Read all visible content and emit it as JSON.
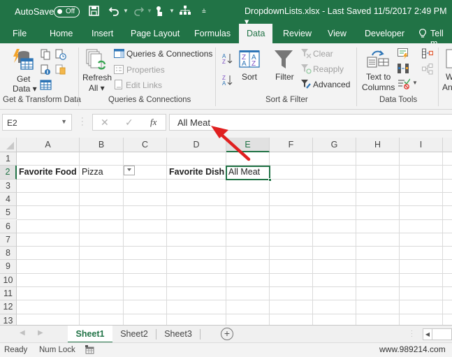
{
  "titlebar": {
    "autosave_label": "AutoSave",
    "autosave_state": "Off",
    "document_title": "DropdownLists.xlsx  -  Last Saved 11/5/2017 2:49 PM  ▾",
    "icons": [
      "save-icon",
      "undo-icon",
      "redo-icon",
      "touch-mode-icon",
      "workflow-icon",
      "customize-qat-icon"
    ]
  },
  "tabs": [
    {
      "label": "File",
      "active": false
    },
    {
      "label": "Home",
      "active": false
    },
    {
      "label": "Insert",
      "active": false
    },
    {
      "label": "Page Layout",
      "active": false
    },
    {
      "label": "Formulas",
      "active": false
    },
    {
      "label": "Data",
      "active": true
    },
    {
      "label": "Review",
      "active": false
    },
    {
      "label": "View",
      "active": false
    },
    {
      "label": "Developer",
      "active": false
    },
    {
      "label": "Tell m",
      "active": false
    }
  ],
  "ribbon": {
    "get_transform": {
      "get_data_line1": "Get",
      "get_data_line2": "Data ▾",
      "group_label": "Get & Transform Data"
    },
    "queries": {
      "refresh_line1": "Refresh",
      "refresh_line2": "All ▾",
      "queries_connections": "Queries & Connections",
      "properties": "Properties",
      "edit_links": "Edit Links",
      "group_label": "Queries & Connections"
    },
    "sort_filter": {
      "sort": "Sort",
      "filter": "Filter",
      "clear": "Clear",
      "reapply": "Reapply",
      "advanced": "Advanced",
      "group_label": "Sort & Filter"
    },
    "data_tools": {
      "text_to_line1": "Text to",
      "text_to_line2": "Columns",
      "group_label": "Data Tools"
    },
    "whatif": {
      "line1": "W",
      "line2": "An"
    }
  },
  "formula_bar": {
    "name_box": "E2",
    "cancel": "✕",
    "enter": "✓",
    "fx": "fx",
    "formula": "All Meat"
  },
  "grid": {
    "columns": [
      "A",
      "B",
      "C",
      "D",
      "E",
      "F",
      "G",
      "H",
      "I"
    ],
    "rows": [
      "1",
      "2",
      "3",
      "4",
      "5",
      "6",
      "7",
      "8",
      "9",
      "10",
      "11",
      "12",
      "13"
    ],
    "selected_cell": "E2",
    "cells": {
      "A2": "Favorite Food",
      "B2": "Pizza",
      "D2": "Favorite Dish",
      "E2": "All Meat"
    }
  },
  "sheets": [
    {
      "label": "Sheet1",
      "active": true
    },
    {
      "label": "Sheet2",
      "active": false
    },
    {
      "label": "Sheet3",
      "active": false
    }
  ],
  "status": {
    "ready": "Ready",
    "num_lock": "Num Lock"
  },
  "watermark": "www.989214.com",
  "colors": {
    "excel_green": "#217346",
    "annotation_arrow": "#e02020"
  }
}
